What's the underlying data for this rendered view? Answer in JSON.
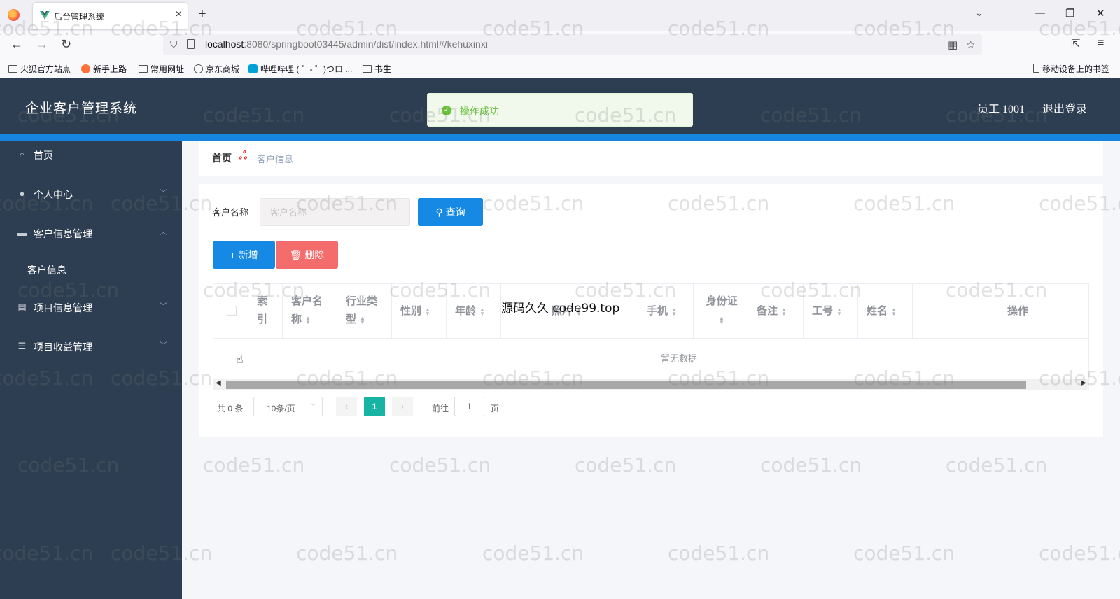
{
  "browser": {
    "tab_title": "后台管理系统",
    "url_host": "localhost",
    "url_rest": ":8080/springboot03445/admin/dist/index.html#/kehuxinxi",
    "bookmarks": [
      "火狐官方站点",
      "新手上路",
      "常用网址",
      "京东商城",
      "哔哩哔哩 ( ゜- ゜)つロ ...",
      "书生"
    ],
    "mobile_bookmarks": "移动设备上的书签"
  },
  "header": {
    "title": "企业客户管理系统",
    "user": "员工 1001",
    "logout": "退出登录"
  },
  "toast": {
    "message": "操作成功"
  },
  "sidebar": {
    "items": [
      {
        "label": "首页"
      },
      {
        "label": "个人中心"
      },
      {
        "label": "客户信息管理"
      },
      {
        "label": "项目信息管理"
      },
      {
        "label": "项目收益管理"
      }
    ],
    "subitem": "客户信息"
  },
  "breadcrumb": {
    "home": "首页",
    "separator": "ஃ",
    "current": "客户信息"
  },
  "search": {
    "label": "客户名称",
    "placeholder": "客户名称",
    "button": "查询"
  },
  "actions": {
    "add": "新增",
    "delete": "删除"
  },
  "table": {
    "columns": [
      "索引",
      "客户名称",
      "行业类型",
      "性别",
      "年龄",
      "照片",
      "手机",
      "身份证",
      "备注",
      "工号",
      "姓名",
      "操作"
    ],
    "empty_text": "暂无数据"
  },
  "pagination": {
    "total": "共 0 条",
    "page_size": "10条/页",
    "current_page": "1",
    "goto_label": "前往",
    "goto_value": "1",
    "page_unit": "页"
  },
  "overlay_text": "源码久久 code99.top",
  "watermark": "code51.cn",
  "colors": {
    "header_bg": "#2e3e52",
    "accent": "#1589e4",
    "danger": "#f56c6c",
    "success": "#67c23a",
    "pager_active": "#17b3a3"
  }
}
